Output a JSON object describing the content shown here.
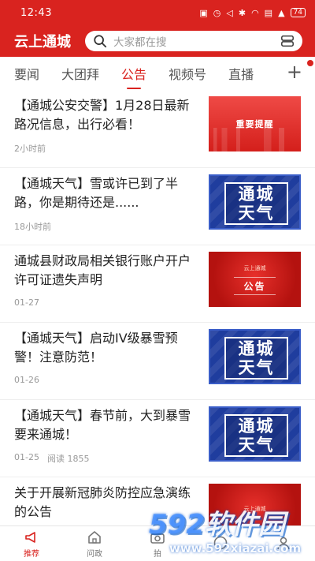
{
  "status_bar": {
    "time": "12:43",
    "battery": "74",
    "icons": [
      "notification-icon",
      "alarm-icon",
      "mute-icon",
      "bluetooth-icon",
      "wifi-icon",
      "hd-icon",
      "signal-icon",
      "battery-icon"
    ]
  },
  "header": {
    "app_title": "云上通城",
    "search_placeholder": "大家都在搜",
    "accent_color": "#d9231f"
  },
  "tabs": [
    {
      "label": "要闻",
      "active": false
    },
    {
      "label": "大团拜",
      "active": false
    },
    {
      "label": "公告",
      "active": true
    },
    {
      "label": "视频号",
      "active": false
    },
    {
      "label": "直播",
      "active": false
    }
  ],
  "tab_add_label": "+",
  "news": [
    {
      "title": "【通城公安交警】1月28日最新路况信息，出行必看！",
      "time": "2小时前",
      "reads": "",
      "thumb_type": "alert",
      "thumb_text": "重要提醒"
    },
    {
      "title": "【通城天气】雪或许已到了半路，你是期待还是......",
      "time": "18小时前",
      "reads": "",
      "thumb_type": "weather",
      "thumb_text_1": "通城",
      "thumb_text_2": "天气"
    },
    {
      "title": "通城县财政局相关银行账户开户许可证遗失声明",
      "time": "01-27",
      "reads": "",
      "thumb_type": "notice",
      "thumb_small": "云上通城",
      "thumb_text": "公告"
    },
    {
      "title": "【通城天气】启动IV级暴雪预警！注意防范！",
      "time": "01-26",
      "reads": "",
      "thumb_type": "weather",
      "thumb_text_1": "通城",
      "thumb_text_2": "天气"
    },
    {
      "title": "【通城天气】春节前，大到暴雪要来通城！",
      "time": "01-25",
      "reads": "阅读 1855",
      "thumb_type": "weather",
      "thumb_text_1": "通城",
      "thumb_text_2": "天气"
    },
    {
      "title": "关于开展新冠肺炎防控应急演练的公告",
      "time": "",
      "reads": "",
      "thumb_type": "notice",
      "thumb_small": "云上通城",
      "thumb_text": ""
    }
  ],
  "bottom_nav": [
    {
      "label": "推荐",
      "icon": "megaphone-icon",
      "active": true
    },
    {
      "label": "问政",
      "icon": "home-icon",
      "active": false
    },
    {
      "label": "拍",
      "icon": "camera-icon",
      "active": false
    },
    {
      "label": "",
      "icon": "compass-icon",
      "active": false
    },
    {
      "label": "",
      "icon": "user-icon",
      "active": false
    }
  ],
  "watermark": {
    "brand_num": "592",
    "brand_text": "软件园",
    "url": "www.592xiazai.com"
  }
}
